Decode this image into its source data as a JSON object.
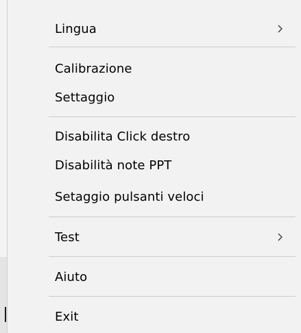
{
  "menu": {
    "items": [
      {
        "label": "Lingua",
        "submenu": true
      },
      {
        "label": "Calibrazione",
        "submenu": false
      },
      {
        "label": "Settaggio",
        "submenu": false
      },
      {
        "label": "Disabilita Click destro",
        "submenu": false
      },
      {
        "label": "Disabilità note PPT",
        "submenu": false
      },
      {
        "label": "Setaggio pulsanti veloci",
        "submenu": false
      },
      {
        "label": "Test",
        "submenu": true
      },
      {
        "label": "Aiuto",
        "submenu": false
      },
      {
        "label": "Exit",
        "submenu": false
      }
    ]
  },
  "colors": {
    "menu_background": "#f2f2f2",
    "separator": "#cccccc",
    "text": "#000000"
  },
  "icons": {
    "submenu_arrow": "chevron-right-icon"
  }
}
